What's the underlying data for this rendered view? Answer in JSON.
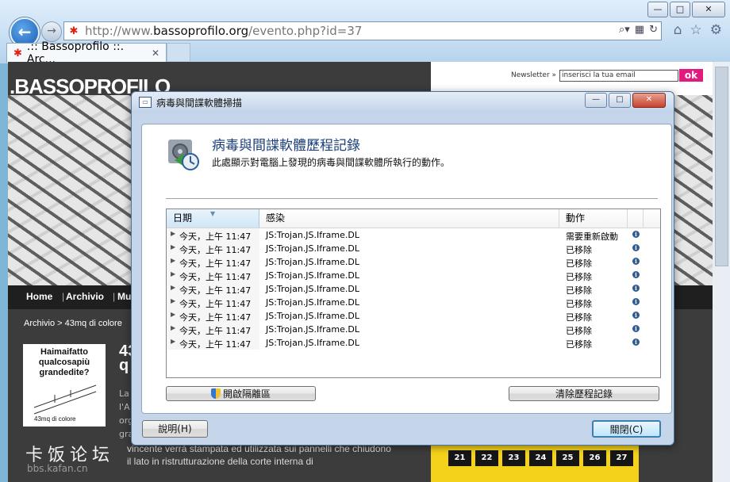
{
  "browser": {
    "url_prefix": "http://www.",
    "url_host": "bassoprofilo.org",
    "url_path": "/evento.php?id=37",
    "tab_title": ".:: Bassoprofilo ::. Arc..."
  },
  "webpage": {
    "newsletter_label": "Newsletter »",
    "newsletter_placeholder": "inserisci la tua email",
    "ok_label": "ok",
    "logo": ".BASSOPROFILO",
    "nav": [
      "Home",
      "Archivio",
      "Mu"
    ],
    "breadcrumb": "Archivio > 43mq di colore",
    "ad_lines": [
      "Haimaifatto",
      "qualcosapiù",
      "grandedite?"
    ],
    "ad_footer": "43mq di colore",
    "big_text": [
      "43",
      "q"
    ],
    "body_snips": [
      "La",
      "l'A",
      "org",
      "gra"
    ],
    "body_text": "vincente verrà stampata ed utilizzata sui pannelli che chiudono il lato in ristrutturazione della corte interna di",
    "watermark_cn": "卡饭论坛",
    "watermark_url": "bbs.kafan.cn",
    "calendar_days": [
      "21",
      "22",
      "23",
      "24",
      "25",
      "26",
      "27"
    ]
  },
  "dialog": {
    "title": "病毒與間諜軟體掃描",
    "heading": "病毒與間諜軟體歷程記錄",
    "description": "此處顯示對電腦上發現的病毒與間諜軟體所執行的動作。",
    "columns": {
      "date": "日期",
      "infection": "感染",
      "action": "動作"
    },
    "rows": [
      {
        "date": "今天，上午 11:47",
        "infection": "JS:Trojan.JS.Iframe.DL",
        "action": "需要重新啟動"
      },
      {
        "date": "今天，上午 11:47",
        "infection": "JS:Trojan.JS.Iframe.DL",
        "action": "已移除"
      },
      {
        "date": "今天，上午 11:47",
        "infection": "JS:Trojan.JS.Iframe.DL",
        "action": "已移除"
      },
      {
        "date": "今天，上午 11:47",
        "infection": "JS:Trojan.JS.Iframe.DL",
        "action": "已移除"
      },
      {
        "date": "今天，上午 11:47",
        "infection": "JS:Trojan.JS.Iframe.DL",
        "action": "已移除"
      },
      {
        "date": "今天，上午 11:47",
        "infection": "JS:Trojan.JS.Iframe.DL",
        "action": "已移除"
      },
      {
        "date": "今天，上午 11:47",
        "infection": "JS:Trojan.JS.Iframe.DL",
        "action": "已移除"
      },
      {
        "date": "今天，上午 11:47",
        "infection": "JS:Trojan.JS.Iframe.DL",
        "action": "已移除"
      },
      {
        "date": "今天，上午 11:47",
        "infection": "JS:Trojan.JS.Iframe.DL",
        "action": "已移除"
      }
    ],
    "buttons": {
      "quarantine": "開啟隔離區",
      "clear": "清除歷程記錄",
      "help": "說明(H)",
      "close": "關閉(C)"
    }
  }
}
